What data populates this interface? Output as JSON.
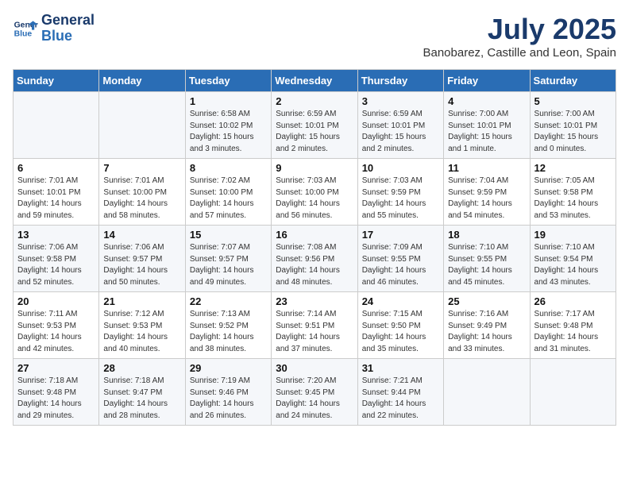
{
  "header": {
    "logo_line1": "General",
    "logo_line2": "Blue",
    "month": "July 2025",
    "location": "Banobarez, Castille and Leon, Spain"
  },
  "days_of_week": [
    "Sunday",
    "Monday",
    "Tuesday",
    "Wednesday",
    "Thursday",
    "Friday",
    "Saturday"
  ],
  "weeks": [
    [
      {
        "day": "",
        "sunrise": "",
        "sunset": "",
        "daylight": ""
      },
      {
        "day": "",
        "sunrise": "",
        "sunset": "",
        "daylight": ""
      },
      {
        "day": "1",
        "sunrise": "Sunrise: 6:58 AM",
        "sunset": "Sunset: 10:02 PM",
        "daylight": "Daylight: 15 hours and 3 minutes."
      },
      {
        "day": "2",
        "sunrise": "Sunrise: 6:59 AM",
        "sunset": "Sunset: 10:01 PM",
        "daylight": "Daylight: 15 hours and 2 minutes."
      },
      {
        "day": "3",
        "sunrise": "Sunrise: 6:59 AM",
        "sunset": "Sunset: 10:01 PM",
        "daylight": "Daylight: 15 hours and 2 minutes."
      },
      {
        "day": "4",
        "sunrise": "Sunrise: 7:00 AM",
        "sunset": "Sunset: 10:01 PM",
        "daylight": "Daylight: 15 hours and 1 minute."
      },
      {
        "day": "5",
        "sunrise": "Sunrise: 7:00 AM",
        "sunset": "Sunset: 10:01 PM",
        "daylight": "Daylight: 15 hours and 0 minutes."
      }
    ],
    [
      {
        "day": "6",
        "sunrise": "Sunrise: 7:01 AM",
        "sunset": "Sunset: 10:01 PM",
        "daylight": "Daylight: 14 hours and 59 minutes."
      },
      {
        "day": "7",
        "sunrise": "Sunrise: 7:01 AM",
        "sunset": "Sunset: 10:00 PM",
        "daylight": "Daylight: 14 hours and 58 minutes."
      },
      {
        "day": "8",
        "sunrise": "Sunrise: 7:02 AM",
        "sunset": "Sunset: 10:00 PM",
        "daylight": "Daylight: 14 hours and 57 minutes."
      },
      {
        "day": "9",
        "sunrise": "Sunrise: 7:03 AM",
        "sunset": "Sunset: 10:00 PM",
        "daylight": "Daylight: 14 hours and 56 minutes."
      },
      {
        "day": "10",
        "sunrise": "Sunrise: 7:03 AM",
        "sunset": "Sunset: 9:59 PM",
        "daylight": "Daylight: 14 hours and 55 minutes."
      },
      {
        "day": "11",
        "sunrise": "Sunrise: 7:04 AM",
        "sunset": "Sunset: 9:59 PM",
        "daylight": "Daylight: 14 hours and 54 minutes."
      },
      {
        "day": "12",
        "sunrise": "Sunrise: 7:05 AM",
        "sunset": "Sunset: 9:58 PM",
        "daylight": "Daylight: 14 hours and 53 minutes."
      }
    ],
    [
      {
        "day": "13",
        "sunrise": "Sunrise: 7:06 AM",
        "sunset": "Sunset: 9:58 PM",
        "daylight": "Daylight: 14 hours and 52 minutes."
      },
      {
        "day": "14",
        "sunrise": "Sunrise: 7:06 AM",
        "sunset": "Sunset: 9:57 PM",
        "daylight": "Daylight: 14 hours and 50 minutes."
      },
      {
        "day": "15",
        "sunrise": "Sunrise: 7:07 AM",
        "sunset": "Sunset: 9:57 PM",
        "daylight": "Daylight: 14 hours and 49 minutes."
      },
      {
        "day": "16",
        "sunrise": "Sunrise: 7:08 AM",
        "sunset": "Sunset: 9:56 PM",
        "daylight": "Daylight: 14 hours and 48 minutes."
      },
      {
        "day": "17",
        "sunrise": "Sunrise: 7:09 AM",
        "sunset": "Sunset: 9:55 PM",
        "daylight": "Daylight: 14 hours and 46 minutes."
      },
      {
        "day": "18",
        "sunrise": "Sunrise: 7:10 AM",
        "sunset": "Sunset: 9:55 PM",
        "daylight": "Daylight: 14 hours and 45 minutes."
      },
      {
        "day": "19",
        "sunrise": "Sunrise: 7:10 AM",
        "sunset": "Sunset: 9:54 PM",
        "daylight": "Daylight: 14 hours and 43 minutes."
      }
    ],
    [
      {
        "day": "20",
        "sunrise": "Sunrise: 7:11 AM",
        "sunset": "Sunset: 9:53 PM",
        "daylight": "Daylight: 14 hours and 42 minutes."
      },
      {
        "day": "21",
        "sunrise": "Sunrise: 7:12 AM",
        "sunset": "Sunset: 9:53 PM",
        "daylight": "Daylight: 14 hours and 40 minutes."
      },
      {
        "day": "22",
        "sunrise": "Sunrise: 7:13 AM",
        "sunset": "Sunset: 9:52 PM",
        "daylight": "Daylight: 14 hours and 38 minutes."
      },
      {
        "day": "23",
        "sunrise": "Sunrise: 7:14 AM",
        "sunset": "Sunset: 9:51 PM",
        "daylight": "Daylight: 14 hours and 37 minutes."
      },
      {
        "day": "24",
        "sunrise": "Sunrise: 7:15 AM",
        "sunset": "Sunset: 9:50 PM",
        "daylight": "Daylight: 14 hours and 35 minutes."
      },
      {
        "day": "25",
        "sunrise": "Sunrise: 7:16 AM",
        "sunset": "Sunset: 9:49 PM",
        "daylight": "Daylight: 14 hours and 33 minutes."
      },
      {
        "day": "26",
        "sunrise": "Sunrise: 7:17 AM",
        "sunset": "Sunset: 9:48 PM",
        "daylight": "Daylight: 14 hours and 31 minutes."
      }
    ],
    [
      {
        "day": "27",
        "sunrise": "Sunrise: 7:18 AM",
        "sunset": "Sunset: 9:48 PM",
        "daylight": "Daylight: 14 hours and 29 minutes."
      },
      {
        "day": "28",
        "sunrise": "Sunrise: 7:18 AM",
        "sunset": "Sunset: 9:47 PM",
        "daylight": "Daylight: 14 hours and 28 minutes."
      },
      {
        "day": "29",
        "sunrise": "Sunrise: 7:19 AM",
        "sunset": "Sunset: 9:46 PM",
        "daylight": "Daylight: 14 hours and 26 minutes."
      },
      {
        "day": "30",
        "sunrise": "Sunrise: 7:20 AM",
        "sunset": "Sunset: 9:45 PM",
        "daylight": "Daylight: 14 hours and 24 minutes."
      },
      {
        "day": "31",
        "sunrise": "Sunrise: 7:21 AM",
        "sunset": "Sunset: 9:44 PM",
        "daylight": "Daylight: 14 hours and 22 minutes."
      },
      {
        "day": "",
        "sunrise": "",
        "sunset": "",
        "daylight": ""
      },
      {
        "day": "",
        "sunrise": "",
        "sunset": "",
        "daylight": ""
      }
    ]
  ]
}
